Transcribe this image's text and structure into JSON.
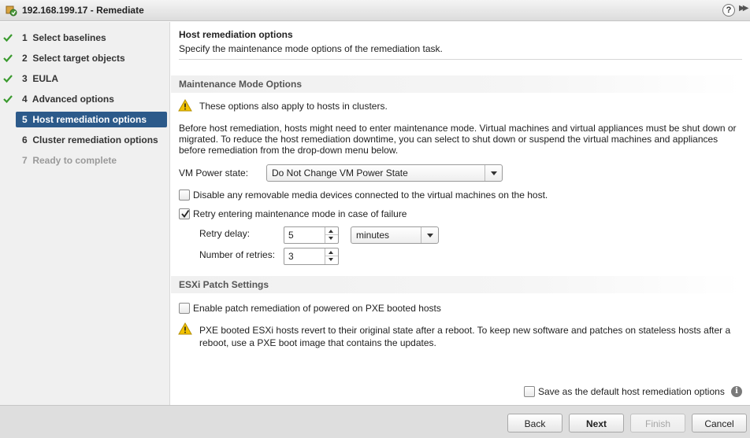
{
  "window": {
    "title": "192.168.199.17 - Remediate",
    "help_label": "?",
    "expand_label": "▶▶"
  },
  "nav": {
    "items": [
      {
        "label": "1  Select baselines",
        "state": "done"
      },
      {
        "label": "2  Select target objects",
        "state": "done"
      },
      {
        "label": "3  EULA",
        "state": "done"
      },
      {
        "label": "4  Advanced options",
        "state": "done"
      },
      {
        "label": "5  Host remediation options",
        "state": "active"
      },
      {
        "label": "6  Cluster remediation options",
        "state": "pending"
      },
      {
        "label": "7  Ready to complete",
        "state": "disabled"
      }
    ]
  },
  "header": {
    "title": "Host remediation options",
    "subtitle": "Specify the maintenance mode options of the remediation task."
  },
  "maintenance": {
    "heading": "Maintenance Mode Options",
    "warning": "These options also apply to hosts in clusters.",
    "desc_line1": "Before host remediation, hosts might need to enter maintenance mode. Virtual machines and virtual appliances must be shut down or",
    "desc_line2": "migrated. To reduce the host remediation downtime, you can select to shut down or suspend the virtual machines and appliances",
    "desc_line3": "before remediation from the drop-down menu below.",
    "vm_power_label": "VM Power state:",
    "vm_power_value": "Do Not Change VM Power State",
    "disable_media_label": "Disable any removable media devices connected to the virtual machines on the host.",
    "disable_media_checked": false,
    "retry_label": "Retry entering maintenance mode in case of failure",
    "retry_checked": true,
    "retry_delay_label": "Retry delay:",
    "retry_delay_value": "5",
    "retry_delay_unit": "minutes",
    "retries_label": "Number of retries:",
    "retries_value": "3"
  },
  "esxi": {
    "heading": "ESXi Patch Settings",
    "pxe_label": "Enable patch remediation of powered on PXE booted hosts",
    "pxe_checked": false,
    "warning_line1": "PXE booted ESXi hosts revert to their original state after a reboot. To keep new software and patches on stateless hosts after a",
    "warning_line2": "reboot, use a PXE boot image that contains the updates."
  },
  "save_default": {
    "label": "Save as the default host remediation options",
    "checked": false,
    "info_icon": "i"
  },
  "buttons": {
    "back": "Back",
    "next": "Next",
    "finish": "Finish",
    "cancel": "Cancel"
  },
  "colors": {
    "active_nav": "#2c5a8a",
    "check": "#3a9a2e",
    "warning": "#f2c200"
  }
}
